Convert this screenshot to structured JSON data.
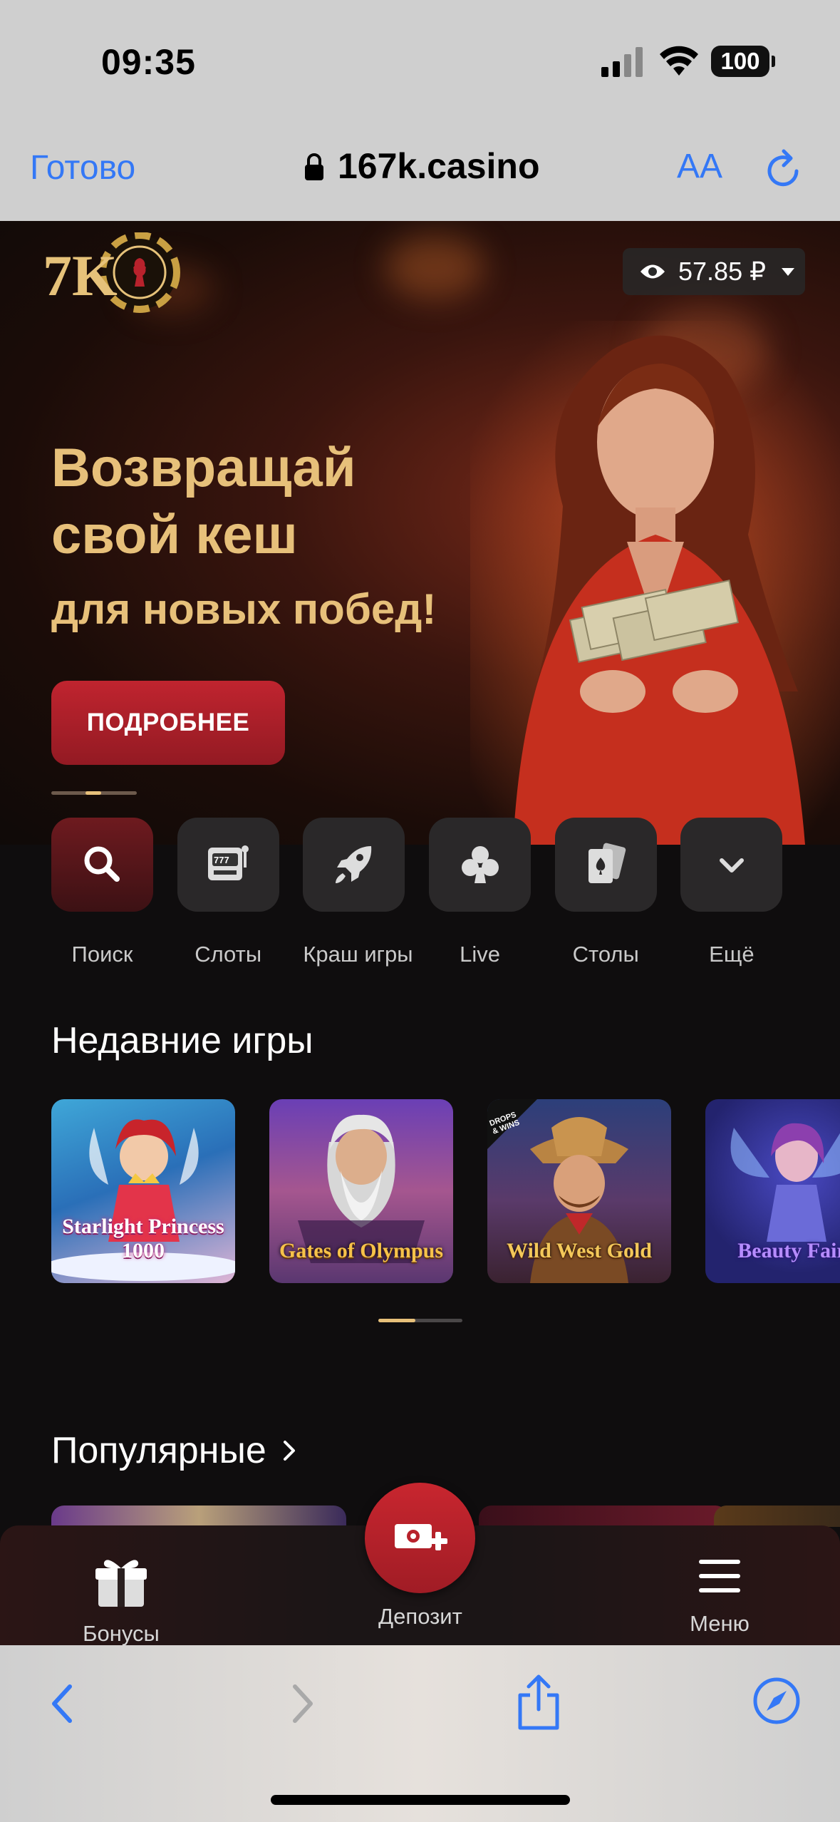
{
  "status_bar": {
    "time": "09:35",
    "battery": "100"
  },
  "browser": {
    "done_label": "Готово",
    "url": "167k.casino",
    "text_size_label": "AA"
  },
  "site": {
    "logo_text": "7K",
    "balance": "57.85 ₽",
    "hero": {
      "title": "Возвращай свой кеш",
      "subtitle": "для новых побед!",
      "cta": "ПОДРОБНЕЕ"
    },
    "categories": [
      {
        "label": "Поиск",
        "icon": "search-icon"
      },
      {
        "label": "Слоты",
        "icon": "slot-machine-icon"
      },
      {
        "label": "Краш игры",
        "icon": "rocket-icon"
      },
      {
        "label": "Live",
        "icon": "club-icon"
      },
      {
        "label": "Столы",
        "icon": "cards-icon"
      },
      {
        "label": "Ещё",
        "icon": "chevron-down-icon"
      }
    ],
    "recent_title": "Недавние игры",
    "recent_games": [
      {
        "name": "Starlight Princess 1000"
      },
      {
        "name": "Gates of Olympus"
      },
      {
        "name": "Wild West Gold",
        "badge": "DROPS & WINS"
      },
      {
        "name": "Beauty Fairy"
      }
    ],
    "popular_title": "Популярные",
    "bottom_nav": {
      "bonuses": "Бонусы",
      "deposit": "Депозит",
      "menu": "Меню"
    }
  },
  "colors": {
    "accent_red": "#b8222c",
    "gold": "#e7c07a",
    "ios_blue": "#3478f6"
  }
}
